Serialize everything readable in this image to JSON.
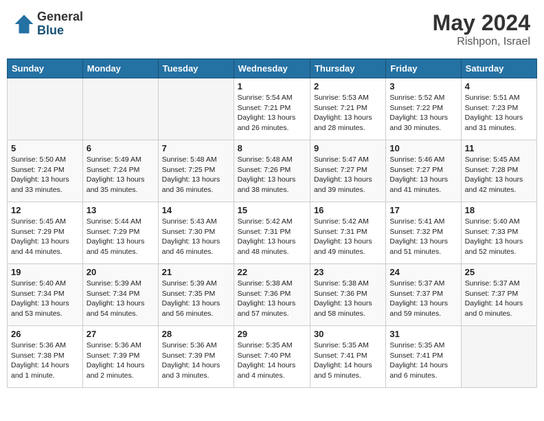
{
  "header": {
    "logo_general": "General",
    "logo_blue": "Blue",
    "month": "May 2024",
    "location": "Rishpon, Israel"
  },
  "columns": [
    "Sunday",
    "Monday",
    "Tuesday",
    "Wednesday",
    "Thursday",
    "Friday",
    "Saturday"
  ],
  "weeks": [
    [
      {
        "day": "",
        "info": ""
      },
      {
        "day": "",
        "info": ""
      },
      {
        "day": "",
        "info": ""
      },
      {
        "day": "1",
        "info": "Sunrise: 5:54 AM\nSunset: 7:21 PM\nDaylight: 13 hours\nand 26 minutes."
      },
      {
        "day": "2",
        "info": "Sunrise: 5:53 AM\nSunset: 7:21 PM\nDaylight: 13 hours\nand 28 minutes."
      },
      {
        "day": "3",
        "info": "Sunrise: 5:52 AM\nSunset: 7:22 PM\nDaylight: 13 hours\nand 30 minutes."
      },
      {
        "day": "4",
        "info": "Sunrise: 5:51 AM\nSunset: 7:23 PM\nDaylight: 13 hours\nand 31 minutes."
      }
    ],
    [
      {
        "day": "5",
        "info": "Sunrise: 5:50 AM\nSunset: 7:24 PM\nDaylight: 13 hours\nand 33 minutes."
      },
      {
        "day": "6",
        "info": "Sunrise: 5:49 AM\nSunset: 7:24 PM\nDaylight: 13 hours\nand 35 minutes."
      },
      {
        "day": "7",
        "info": "Sunrise: 5:48 AM\nSunset: 7:25 PM\nDaylight: 13 hours\nand 36 minutes."
      },
      {
        "day": "8",
        "info": "Sunrise: 5:48 AM\nSunset: 7:26 PM\nDaylight: 13 hours\nand 38 minutes."
      },
      {
        "day": "9",
        "info": "Sunrise: 5:47 AM\nSunset: 7:27 PM\nDaylight: 13 hours\nand 39 minutes."
      },
      {
        "day": "10",
        "info": "Sunrise: 5:46 AM\nSunset: 7:27 PM\nDaylight: 13 hours\nand 41 minutes."
      },
      {
        "day": "11",
        "info": "Sunrise: 5:45 AM\nSunset: 7:28 PM\nDaylight: 13 hours\nand 42 minutes."
      }
    ],
    [
      {
        "day": "12",
        "info": "Sunrise: 5:45 AM\nSunset: 7:29 PM\nDaylight: 13 hours\nand 44 minutes."
      },
      {
        "day": "13",
        "info": "Sunrise: 5:44 AM\nSunset: 7:29 PM\nDaylight: 13 hours\nand 45 minutes."
      },
      {
        "day": "14",
        "info": "Sunrise: 5:43 AM\nSunset: 7:30 PM\nDaylight: 13 hours\nand 46 minutes."
      },
      {
        "day": "15",
        "info": "Sunrise: 5:42 AM\nSunset: 7:31 PM\nDaylight: 13 hours\nand 48 minutes."
      },
      {
        "day": "16",
        "info": "Sunrise: 5:42 AM\nSunset: 7:31 PM\nDaylight: 13 hours\nand 49 minutes."
      },
      {
        "day": "17",
        "info": "Sunrise: 5:41 AM\nSunset: 7:32 PM\nDaylight: 13 hours\nand 51 minutes."
      },
      {
        "day": "18",
        "info": "Sunrise: 5:40 AM\nSunset: 7:33 PM\nDaylight: 13 hours\nand 52 minutes."
      }
    ],
    [
      {
        "day": "19",
        "info": "Sunrise: 5:40 AM\nSunset: 7:34 PM\nDaylight: 13 hours\nand 53 minutes."
      },
      {
        "day": "20",
        "info": "Sunrise: 5:39 AM\nSunset: 7:34 PM\nDaylight: 13 hours\nand 54 minutes."
      },
      {
        "day": "21",
        "info": "Sunrise: 5:39 AM\nSunset: 7:35 PM\nDaylight: 13 hours\nand 56 minutes."
      },
      {
        "day": "22",
        "info": "Sunrise: 5:38 AM\nSunset: 7:36 PM\nDaylight: 13 hours\nand 57 minutes."
      },
      {
        "day": "23",
        "info": "Sunrise: 5:38 AM\nSunset: 7:36 PM\nDaylight: 13 hours\nand 58 minutes."
      },
      {
        "day": "24",
        "info": "Sunrise: 5:37 AM\nSunset: 7:37 PM\nDaylight: 13 hours\nand 59 minutes."
      },
      {
        "day": "25",
        "info": "Sunrise: 5:37 AM\nSunset: 7:37 PM\nDaylight: 14 hours\nand 0 minutes."
      }
    ],
    [
      {
        "day": "26",
        "info": "Sunrise: 5:36 AM\nSunset: 7:38 PM\nDaylight: 14 hours\nand 1 minute."
      },
      {
        "day": "27",
        "info": "Sunrise: 5:36 AM\nSunset: 7:39 PM\nDaylight: 14 hours\nand 2 minutes."
      },
      {
        "day": "28",
        "info": "Sunrise: 5:36 AM\nSunset: 7:39 PM\nDaylight: 14 hours\nand 3 minutes."
      },
      {
        "day": "29",
        "info": "Sunrise: 5:35 AM\nSunset: 7:40 PM\nDaylight: 14 hours\nand 4 minutes."
      },
      {
        "day": "30",
        "info": "Sunrise: 5:35 AM\nSunset: 7:41 PM\nDaylight: 14 hours\nand 5 minutes."
      },
      {
        "day": "31",
        "info": "Sunrise: 5:35 AM\nSunset: 7:41 PM\nDaylight: 14 hours\nand 6 minutes."
      },
      {
        "day": "",
        "info": ""
      }
    ]
  ]
}
